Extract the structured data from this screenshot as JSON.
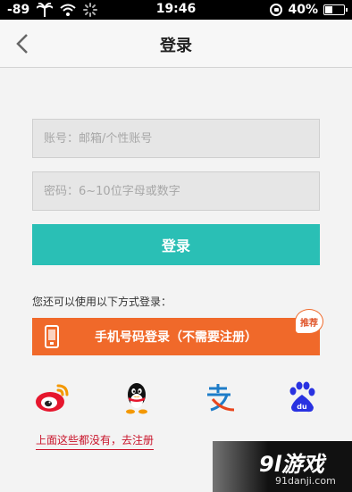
{
  "status_bar": {
    "signal": "-89",
    "time": "19:46",
    "battery": "40%",
    "battery_level": 0.4
  },
  "nav": {
    "title": "登录"
  },
  "form": {
    "account_placeholder": "账号：邮箱/个性账号",
    "password_placeholder": "密码：6~10位字母或数字",
    "login_label": "登录"
  },
  "alternatives": {
    "hint": "您还可以使用以下方式登录：",
    "phone_login_label": "手机号码登录（不需要注册）",
    "recommend_badge": "推荐",
    "icons": [
      "weibo-icon",
      "qq-icon",
      "alipay-icon",
      "baidu-icon"
    ]
  },
  "register": {
    "link_label": "上面这些都没有，去注册"
  },
  "watermark": {
    "logo": "9l游戏",
    "url": "91danji.com"
  },
  "colors": {
    "teal": "#2abfb5",
    "orange": "#f0692a",
    "register_red": "#c9152b"
  }
}
